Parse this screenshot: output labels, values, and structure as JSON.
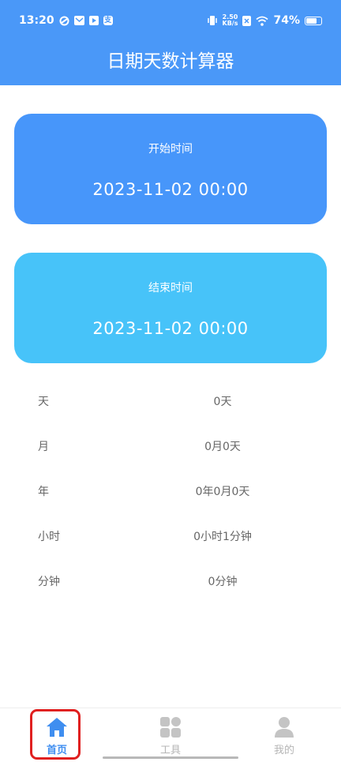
{
  "status_bar": {
    "time": "13:20",
    "notif_alipay": "支",
    "net_speed_value": "2.50",
    "net_speed_unit": "KB/s",
    "battery": "74%",
    "battery_level": 0.74
  },
  "header": {
    "title": "日期天数计算器"
  },
  "start_card": {
    "label": "开始时间",
    "value": "2023-11-02 00:00"
  },
  "end_card": {
    "label": "结束时间",
    "value": "2023-11-02 00:00"
  },
  "results": [
    {
      "label": "天",
      "value": "0天"
    },
    {
      "label": "月",
      "value": "0月0天"
    },
    {
      "label": "年",
      "value": "0年0月0天"
    },
    {
      "label": "小时",
      "value": "0小时1分钟"
    },
    {
      "label": "分钟",
      "value": "0分钟"
    }
  ],
  "tabs": [
    {
      "label": "首页",
      "icon": "home-icon",
      "active": true
    },
    {
      "label": "工具",
      "icon": "tools-grid-icon",
      "active": false
    },
    {
      "label": "我的",
      "icon": "person-icon",
      "active": false
    }
  ],
  "colors": {
    "header": "#4a98f8",
    "start_card": "#4796fa",
    "end_card": "#47c3f9",
    "active_tab": "#3f8ef0",
    "inactive_tab": "#b5b5b5",
    "highlight": "#e02020"
  }
}
